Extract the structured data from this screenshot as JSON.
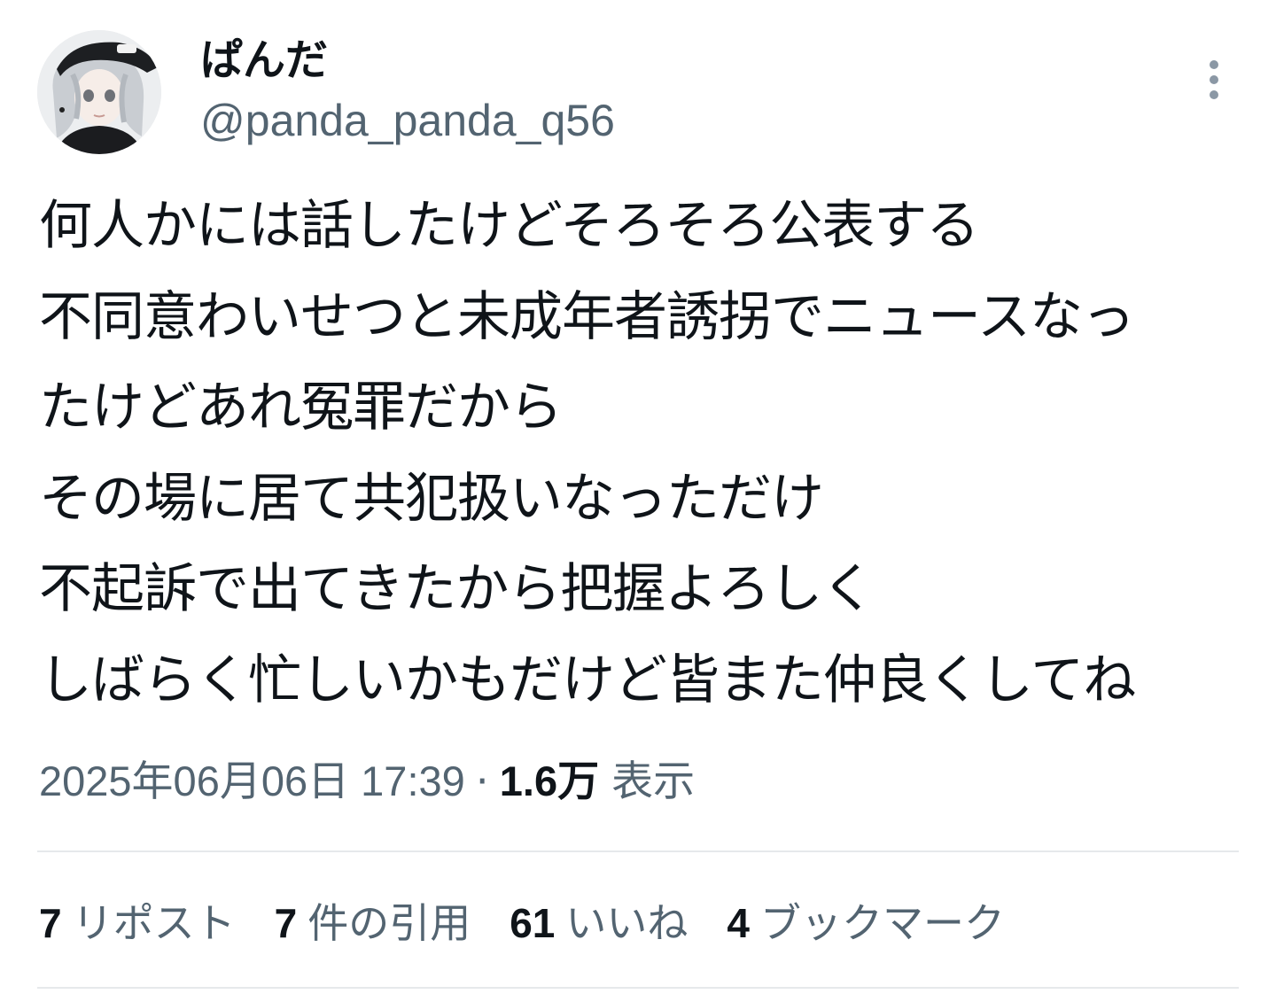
{
  "user": {
    "display_name": "ぱんだ",
    "handle": "@panda_panda_q56",
    "avatar_icon": "avatar-image"
  },
  "more_icon": "more-vertical-icon",
  "tweet": {
    "lines": [
      "何人かには話したけどそろそろ公表する",
      "不同意わいせつと未成年者誘拐でニュースなっ",
      "たけどあれ冤罪だから",
      "その場に居て共犯扱いなっただけ",
      "不起訴で出てきたから把握よろしく",
      "しばらく忙しいかもだけど皆また仲良くしてね"
    ]
  },
  "meta": {
    "timestamp": "2025年06月06日 17:39",
    "separator": "·",
    "views_count": "1.6万",
    "views_label": "表示"
  },
  "stats": {
    "reposts": {
      "count": "7",
      "label": "リポスト"
    },
    "quotes": {
      "count": "7",
      "label": "件の引用"
    },
    "likes": {
      "count": "61",
      "label": "いいね"
    },
    "bookmarks": {
      "count": "4",
      "label": "ブックマーク"
    }
  },
  "colors": {
    "text_primary": "#0f1419",
    "text_secondary": "#536471",
    "divider": "#e6e9eb"
  }
}
